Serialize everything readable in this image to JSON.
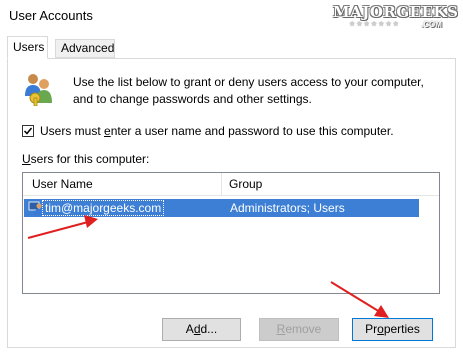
{
  "window": {
    "title": "User Accounts"
  },
  "watermark": {
    "text": "MAJORGEEKS",
    "stars": "★★★★★★★",
    "suffix": ".COM"
  },
  "tabs": [
    {
      "label": "Users"
    },
    {
      "label": "Advanced"
    }
  ],
  "intro_text": "Use the list below to grant or deny users access to your computer, and to change passwords and other settings.",
  "checkbox": {
    "label_pre": "Users must ",
    "label_accel": "e",
    "label_post": "nter a user name and password to use this computer.",
    "checked": true
  },
  "users_for": {
    "accel": "U",
    "rest": "sers for this computer:"
  },
  "table": {
    "columns": [
      "User Name",
      "Group"
    ],
    "rows": [
      {
        "user": "tim@majorgeeks.com",
        "group": "Administrators; Users",
        "selected": true
      }
    ]
  },
  "buttons": {
    "add": {
      "pre": "A",
      "accel": "d",
      "post": "d..."
    },
    "remove": {
      "accel": "R",
      "post": "emove"
    },
    "properties": {
      "pre": "Pr",
      "accel": "o",
      "post": "perties"
    }
  },
  "colors": {
    "selection": "#3c7fd4",
    "annotation_arrow": "#e02020"
  },
  "icons": {
    "users_panel": "users-icon",
    "row": "user-icon"
  }
}
